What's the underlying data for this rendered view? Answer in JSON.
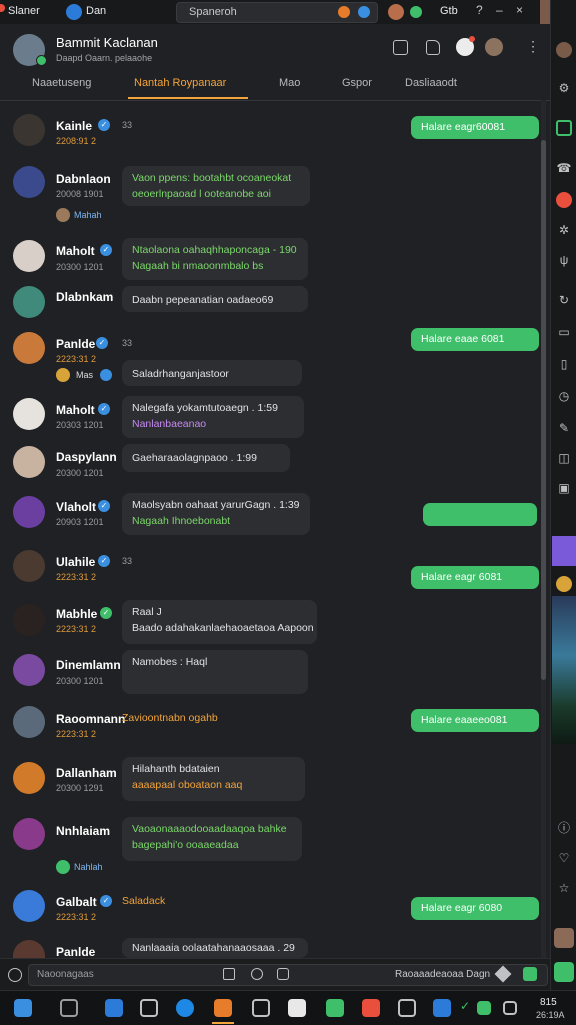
{
  "topbar": {
    "app_name": "Slaner",
    "sub_label": "Dan",
    "search_text": "Spaneroh",
    "right_label": "Gtb"
  },
  "header": {
    "title": "Bammit Kaclanan",
    "subtitle": "Daapd Oaarn. pelaaohe"
  },
  "tabs": [
    {
      "label": "Naaetuseng",
      "active": false
    },
    {
      "label": "Nantah Roypanaar",
      "active": true
    },
    {
      "label": "Mao",
      "active": false
    },
    {
      "label": "Gspor",
      "active": false
    },
    {
      "label": "Dasliaaodt",
      "active": false
    }
  ],
  "messages": [
    {
      "name": "Kainle",
      "time": "2208:91 2",
      "extra": "33",
      "text1": "",
      "text2": ""
    },
    {
      "name": "Dabnlaon",
      "time": "20008 1901",
      "text1": "Vaon ppens: bootahbt ocoaneokat",
      "text2": "oeoerlnpaoad l ooteanobe aoi",
      "sub": "Mahah"
    },
    {
      "name": "Maholt",
      "time": "20300 1201",
      "text1": "Ntaolaona oahaqhhaponcaga - 190",
      "text2": "Nagaah bi nmaoonmbalo bs"
    },
    {
      "name": "Dlabnkam",
      "time": "",
      "text1": "Daabn pepeanatian oadaeo69",
      "text2": ""
    },
    {
      "name": "Panlde",
      "time": "2223:31 2",
      "extra": "33",
      "text1": "Saladrhanganjastoor",
      "text2": "",
      "sub": "Mas"
    },
    {
      "name": "Maholt",
      "time": "20303 1201",
      "text1": "Nalegafa yokamtutoaegn . 1:59",
      "text2": "Nanlanbaeanao"
    },
    {
      "name": "Daspylann",
      "time": "20300 1201",
      "text1": "Gaeharaaolagnpaoo . 1:99",
      "text2": ""
    },
    {
      "name": "Vlaholt",
      "time": "20903 1201",
      "text1": "Maolsyabn oahaat yarurGagn . 1:39",
      "text2": "Nagaah Ihnoebonabt"
    },
    {
      "name": "Ulahile",
      "time": "2223:31 2",
      "extra": "33",
      "text1": "",
      "text2": ""
    },
    {
      "name": "Mabhle",
      "time": "2223:31 2",
      "text1": "Raal J",
      "text2": "Baado adahakanlaehaoaetaoa Aapoon"
    },
    {
      "name": "Dinemlamn",
      "time": "20300 1201",
      "text1": "Namobes : Haql",
      "text2": ""
    },
    {
      "name": "Raoomnann",
      "time": "2223:31 2",
      "text1": "Zavioontnabn ogahb",
      "text2": ""
    },
    {
      "name": "Dallanham",
      "time": "20300 1291",
      "text1": "Hilahanth bdataien",
      "text2": "aaaapaal oboataon aaq"
    },
    {
      "name": "Nnhlaiam",
      "time": "",
      "text1": "Vaoaonaaaodooaadaaqoa bahke",
      "text2": "bagepahi'o ooaaeadaa",
      "sub": "Nahlah"
    },
    {
      "name": "Galbalt",
      "time": "2223:31 2",
      "text1": "Saladack",
      "text2": ""
    },
    {
      "name": "Panlde",
      "time": "",
      "text1": "Nanlaaaia oolaatahanaaosaaa . 29",
      "text2": ""
    }
  ],
  "outgoing": [
    {
      "text": "Halare eagr60081"
    },
    {
      "text": "Halare eaae 6081"
    },
    {
      "text": ""
    },
    {
      "text": "Halare eagr 6081"
    },
    {
      "text": "Halare eaaeeo081"
    },
    {
      "text": "Halare eagr 6080"
    }
  ],
  "input": {
    "left_label": "Naoonagaas",
    "right_label": "Raoaaadeaoaa Dagn"
  },
  "taskbar": {
    "clock_time": "815",
    "clock_date": "26:19A"
  },
  "colors": {
    "background": "#202124",
    "bubble": "#2d2e32",
    "outgoing": "#3fbf6a",
    "accent_tab": "#f3a43a",
    "badge_blue": "#3a8fe0"
  }
}
